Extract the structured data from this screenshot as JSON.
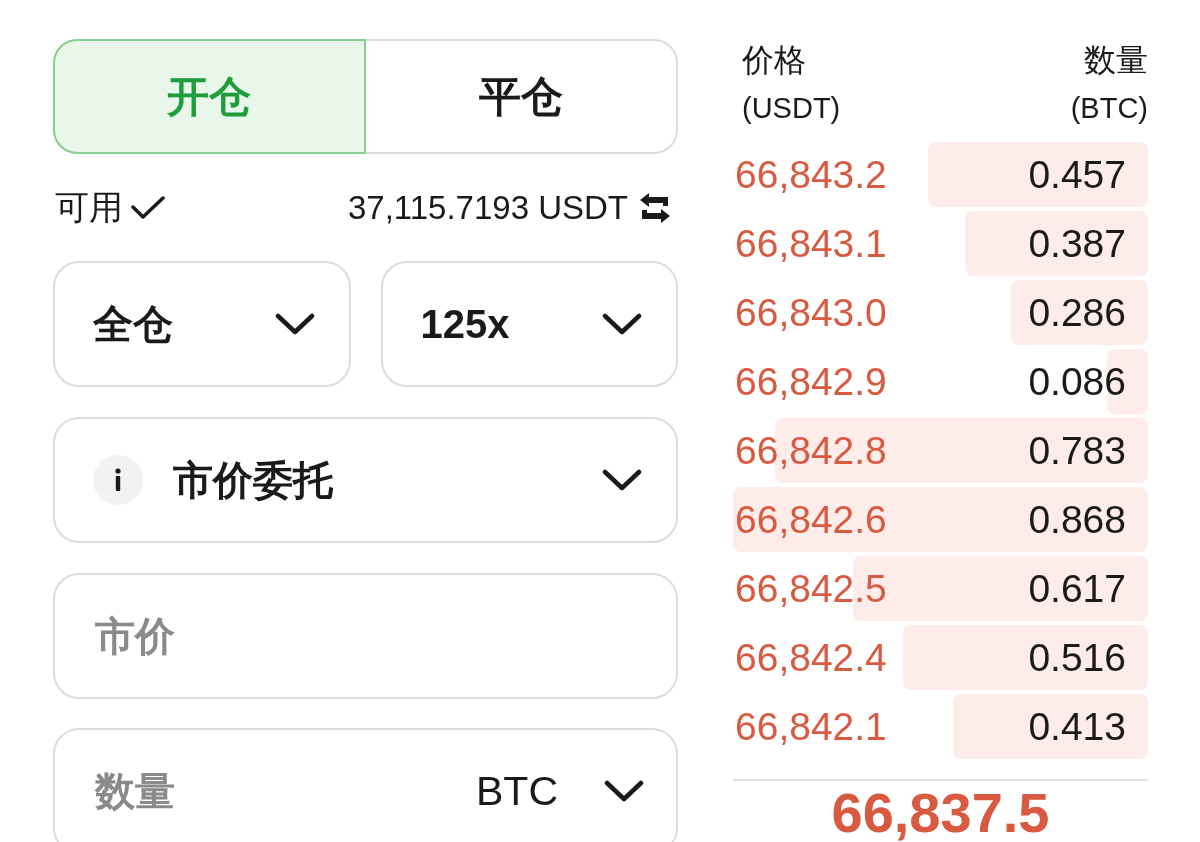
{
  "tabs": [
    {
      "label": "开仓",
      "selected": true
    },
    {
      "label": "平仓",
      "selected": false
    }
  ],
  "available": {
    "label": "可用",
    "value": "37,115.7193 USDT"
  },
  "margin_mode": {
    "value": "全仓"
  },
  "leverage": {
    "value": "125x"
  },
  "order_type": {
    "value": "市价委托"
  },
  "price_field": {
    "placeholder": "市价"
  },
  "quantity_field": {
    "placeholder": "数量",
    "unit": "BTC"
  },
  "order_book": {
    "columns": [
      {
        "label": "价格",
        "unit": "(USDT)"
      },
      {
        "label": "数量",
        "unit": "(BTC)"
      }
    ],
    "asks": [
      {
        "price": "66,843.2",
        "amount": "0.457",
        "level": 0.53
      },
      {
        "price": "66,843.1",
        "amount": "0.387",
        "level": 0.44
      },
      {
        "price": "66,843.0",
        "amount": "0.286",
        "level": 0.33
      },
      {
        "price": "66,842.9",
        "amount": "0.086",
        "level": 0.1
      },
      {
        "price": "66,842.8",
        "amount": "0.783",
        "level": 0.9
      },
      {
        "price": "66,842.6",
        "amount": "0.868",
        "level": 1.0
      },
      {
        "price": "66,842.5",
        "amount": "0.617",
        "level": 0.71
      },
      {
        "price": "66,842.4",
        "amount": "0.516",
        "level": 0.59
      },
      {
        "price": "66,842.1",
        "amount": "0.413",
        "level": 0.47
      }
    ],
    "last_price": "66,837.5"
  }
}
